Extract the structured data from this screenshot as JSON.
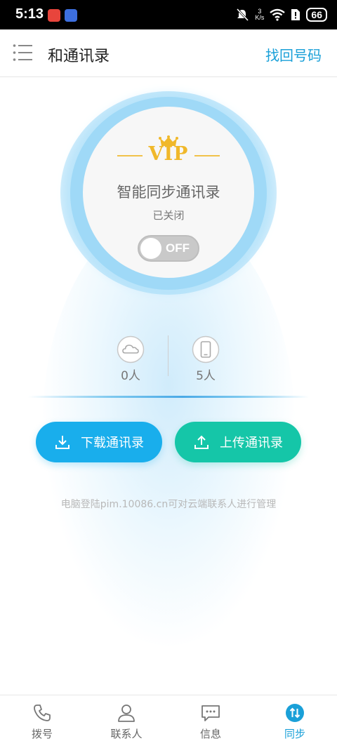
{
  "status_bar": {
    "time": "5:13",
    "speed_value": "3",
    "speed_unit": "K/s",
    "battery": "66"
  },
  "header": {
    "title": "和通讯录",
    "action": "找回号码"
  },
  "sync": {
    "badge": "VIP",
    "title": "智能同步通讯录",
    "status": "已关闭",
    "toggle_label": "OFF",
    "toggle_on": false
  },
  "counts": {
    "cloud": "0人",
    "phone": "5人"
  },
  "buttons": {
    "download": "下载通讯录",
    "upload": "上传通讯录"
  },
  "hint": "电脑登陆pim.10086.cn可对云端联系人进行管理",
  "tabs": [
    {
      "label": "拨号",
      "icon": "phone-icon"
    },
    {
      "label": "联系人",
      "icon": "person-icon"
    },
    {
      "label": "信息",
      "icon": "message-icon"
    },
    {
      "label": "同步",
      "icon": "sync-icon",
      "active": true
    }
  ],
  "colors": {
    "accent_blue": "#1aa0d8",
    "download_button": "#19aeec",
    "upload_button": "#15c6a8",
    "vip_gold": "#f0b82a"
  }
}
